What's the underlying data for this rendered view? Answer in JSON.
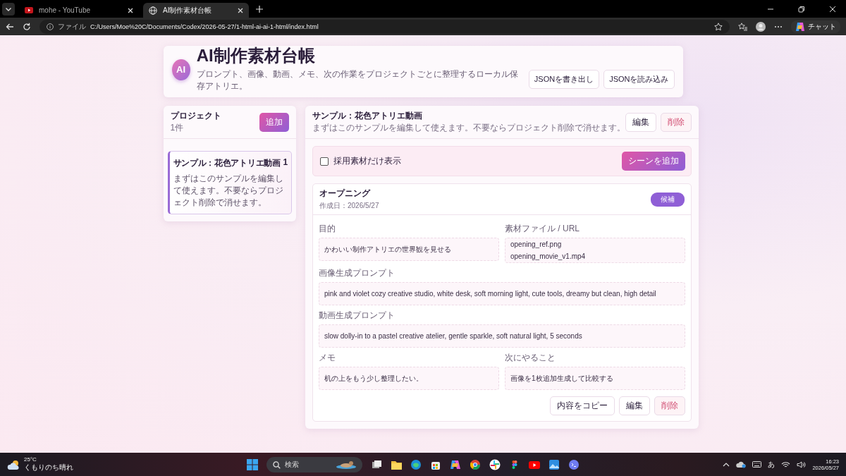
{
  "browser": {
    "tabs": [
      {
        "title": "mohe - YouTube",
        "kind": "video",
        "selected": false
      },
      {
        "title": "AI制作素材台帳",
        "kind": "web",
        "selected": true
      }
    ],
    "address": {
      "scheme": "ファイル",
      "url": "C:/Users/Moe%20C/Documents/Codex/2026-05-27/1-html-ai-ai-1-html/index.html"
    },
    "chat_button": "チャット"
  },
  "header": {
    "logo": "AI",
    "title": "AI制作素材台帳",
    "subtitle": "プロンプト、画像、動画、メモ、次の作業をプロジェクトごとに整理するローカル保存アトリエ。",
    "buttons": [
      "JSONを書き出し",
      "JSONを読み込み"
    ]
  },
  "projects": {
    "title": "プロジェクト",
    "count": "1件",
    "add_button": "追加",
    "items": [
      {
        "name": "サンプル：花色アトリエ動画",
        "scenes": "1",
        "description": "まずはこのサンプルを編集して使えます。不要ならプロジェクト削除で消せます。",
        "selected": true
      }
    ]
  },
  "project_detail": {
    "title": "サンプル：花色アトリエ動画",
    "description": "まずはこのサンプルを編集して使えます。不要ならプロジェクト削除で消せます。",
    "buttons": [
      {
        "label": "編集",
        "kind": "normal"
      },
      {
        "label": "削除",
        "kind": "danger"
      }
    ],
    "filter": {
      "label": "採用素材だけ表示",
      "checked": false
    },
    "add_scene_button": "シーンを追加",
    "scenes": [
      {
        "title": "オープニング",
        "created": "作成日：2026/5/27",
        "status": "候補",
        "fields": [
          {
            "label": "目的",
            "lines": [
              "かわいい制作アトリエの世界観を見せる"
            ],
            "kind": "half"
          },
          {
            "label": "素材ファイル / URL",
            "lines": [
              "opening_ref.png",
              "opening_movie_v1.mp4"
            ],
            "kind": "half"
          },
          {
            "label": "画像生成プロンプト",
            "lines": [
              "pink and violet cozy creative studio, white desk, soft morning light, cute tools, dreamy but clean, high detail"
            ],
            "kind": "full"
          },
          {
            "label": "動画生成プロンプト",
            "lines": [
              "slow dolly-in to a pastel creative atelier, gentle sparkle, soft natural light, 5 seconds"
            ],
            "kind": "full"
          },
          {
            "label": "メモ",
            "lines": [
              "机の上をもう少し整理したい。"
            ],
            "kind": "half"
          },
          {
            "label": "次にやること",
            "lines": [
              "画像を1枚追加生成して比較する"
            ],
            "kind": "half"
          }
        ],
        "buttons": [
          {
            "label": "内容をコピー",
            "kind": "normal"
          },
          {
            "label": "編集",
            "kind": "normal"
          },
          {
            "label": "削除",
            "kind": "danger"
          }
        ]
      }
    ]
  },
  "taskbar": {
    "weather": {
      "temperature": "25°C",
      "condition": "くもりのち晴れ"
    },
    "search_placeholder": "検索",
    "ime": "あ",
    "time": "16:23",
    "date": "2026/05/27"
  }
}
